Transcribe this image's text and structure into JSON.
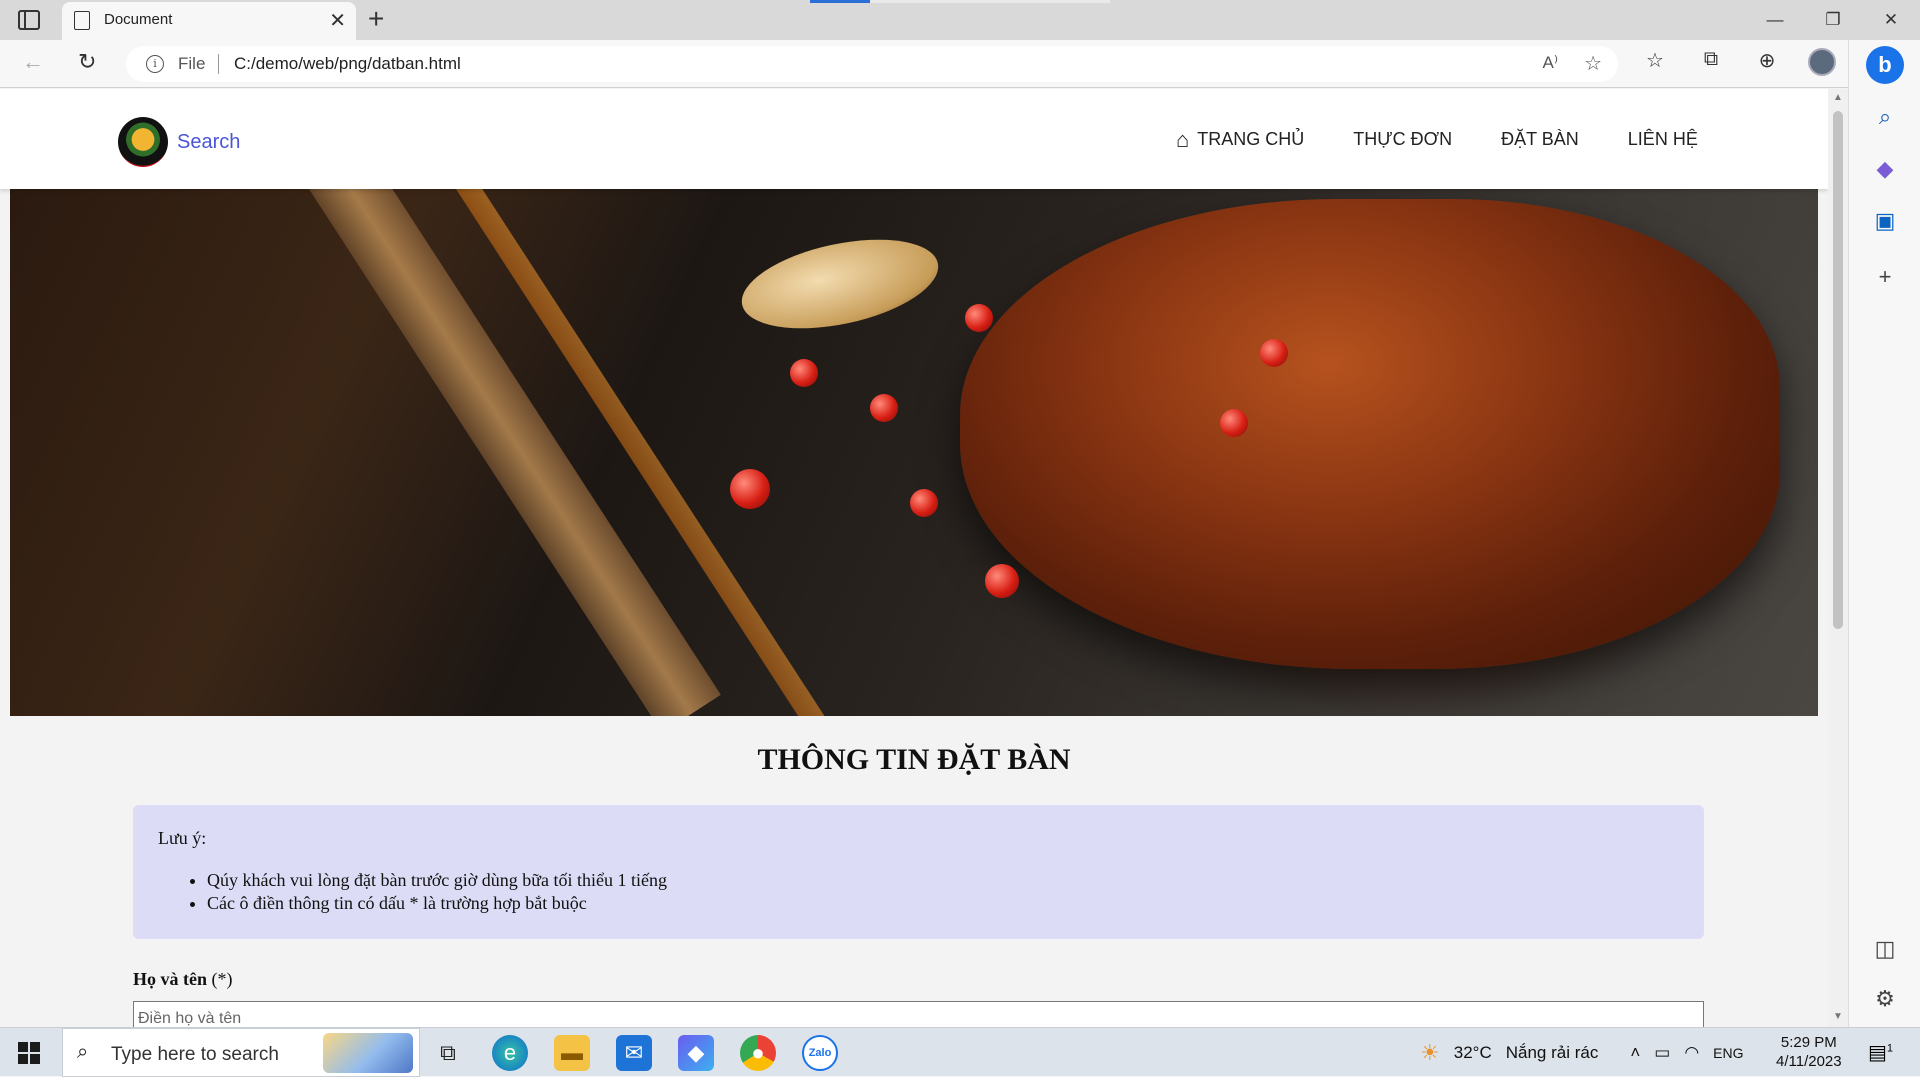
{
  "browser": {
    "tab_title": "Document",
    "tab_close": "✕",
    "new_tab": "+",
    "file_label": "File",
    "url": "C:/demo/web/png/datban.html",
    "read_aloud": "A⁾",
    "window_controls": [
      "—",
      "❐",
      "✕"
    ]
  },
  "site": {
    "logo_text": "Search",
    "nav": [
      "TRANG CHỦ",
      "THỰC ĐƠN",
      "ĐẶT BÀN",
      "LIÊN HỆ"
    ],
    "home_icon": "⌂"
  },
  "booking": {
    "title": "THÔNG TIN ĐẶT BÀN",
    "note_title": "Lưu ý:",
    "notes": [
      "Qúy khách vui lòng đặt bàn trước giờ dùng bữa tối thiểu 1 tiếng",
      "Các ô điền thông tin có dấu * là trường hợp bắt buộc"
    ],
    "name_label": "Họ và tên",
    "name_required": " (*)",
    "name_placeholder": "Điền họ và tên"
  },
  "taskbar": {
    "search_placeholder": "Type here to search",
    "temperature": "32°C",
    "weather": "Nắng rải rác",
    "language": "ENG",
    "time": "5:29 PM",
    "date": "4/11/2023",
    "notification_count": "1"
  },
  "colors": {
    "accent": "#4a56d6",
    "note_bg": "#dcdcf6",
    "taskbar_bg": "#dde3ea"
  }
}
